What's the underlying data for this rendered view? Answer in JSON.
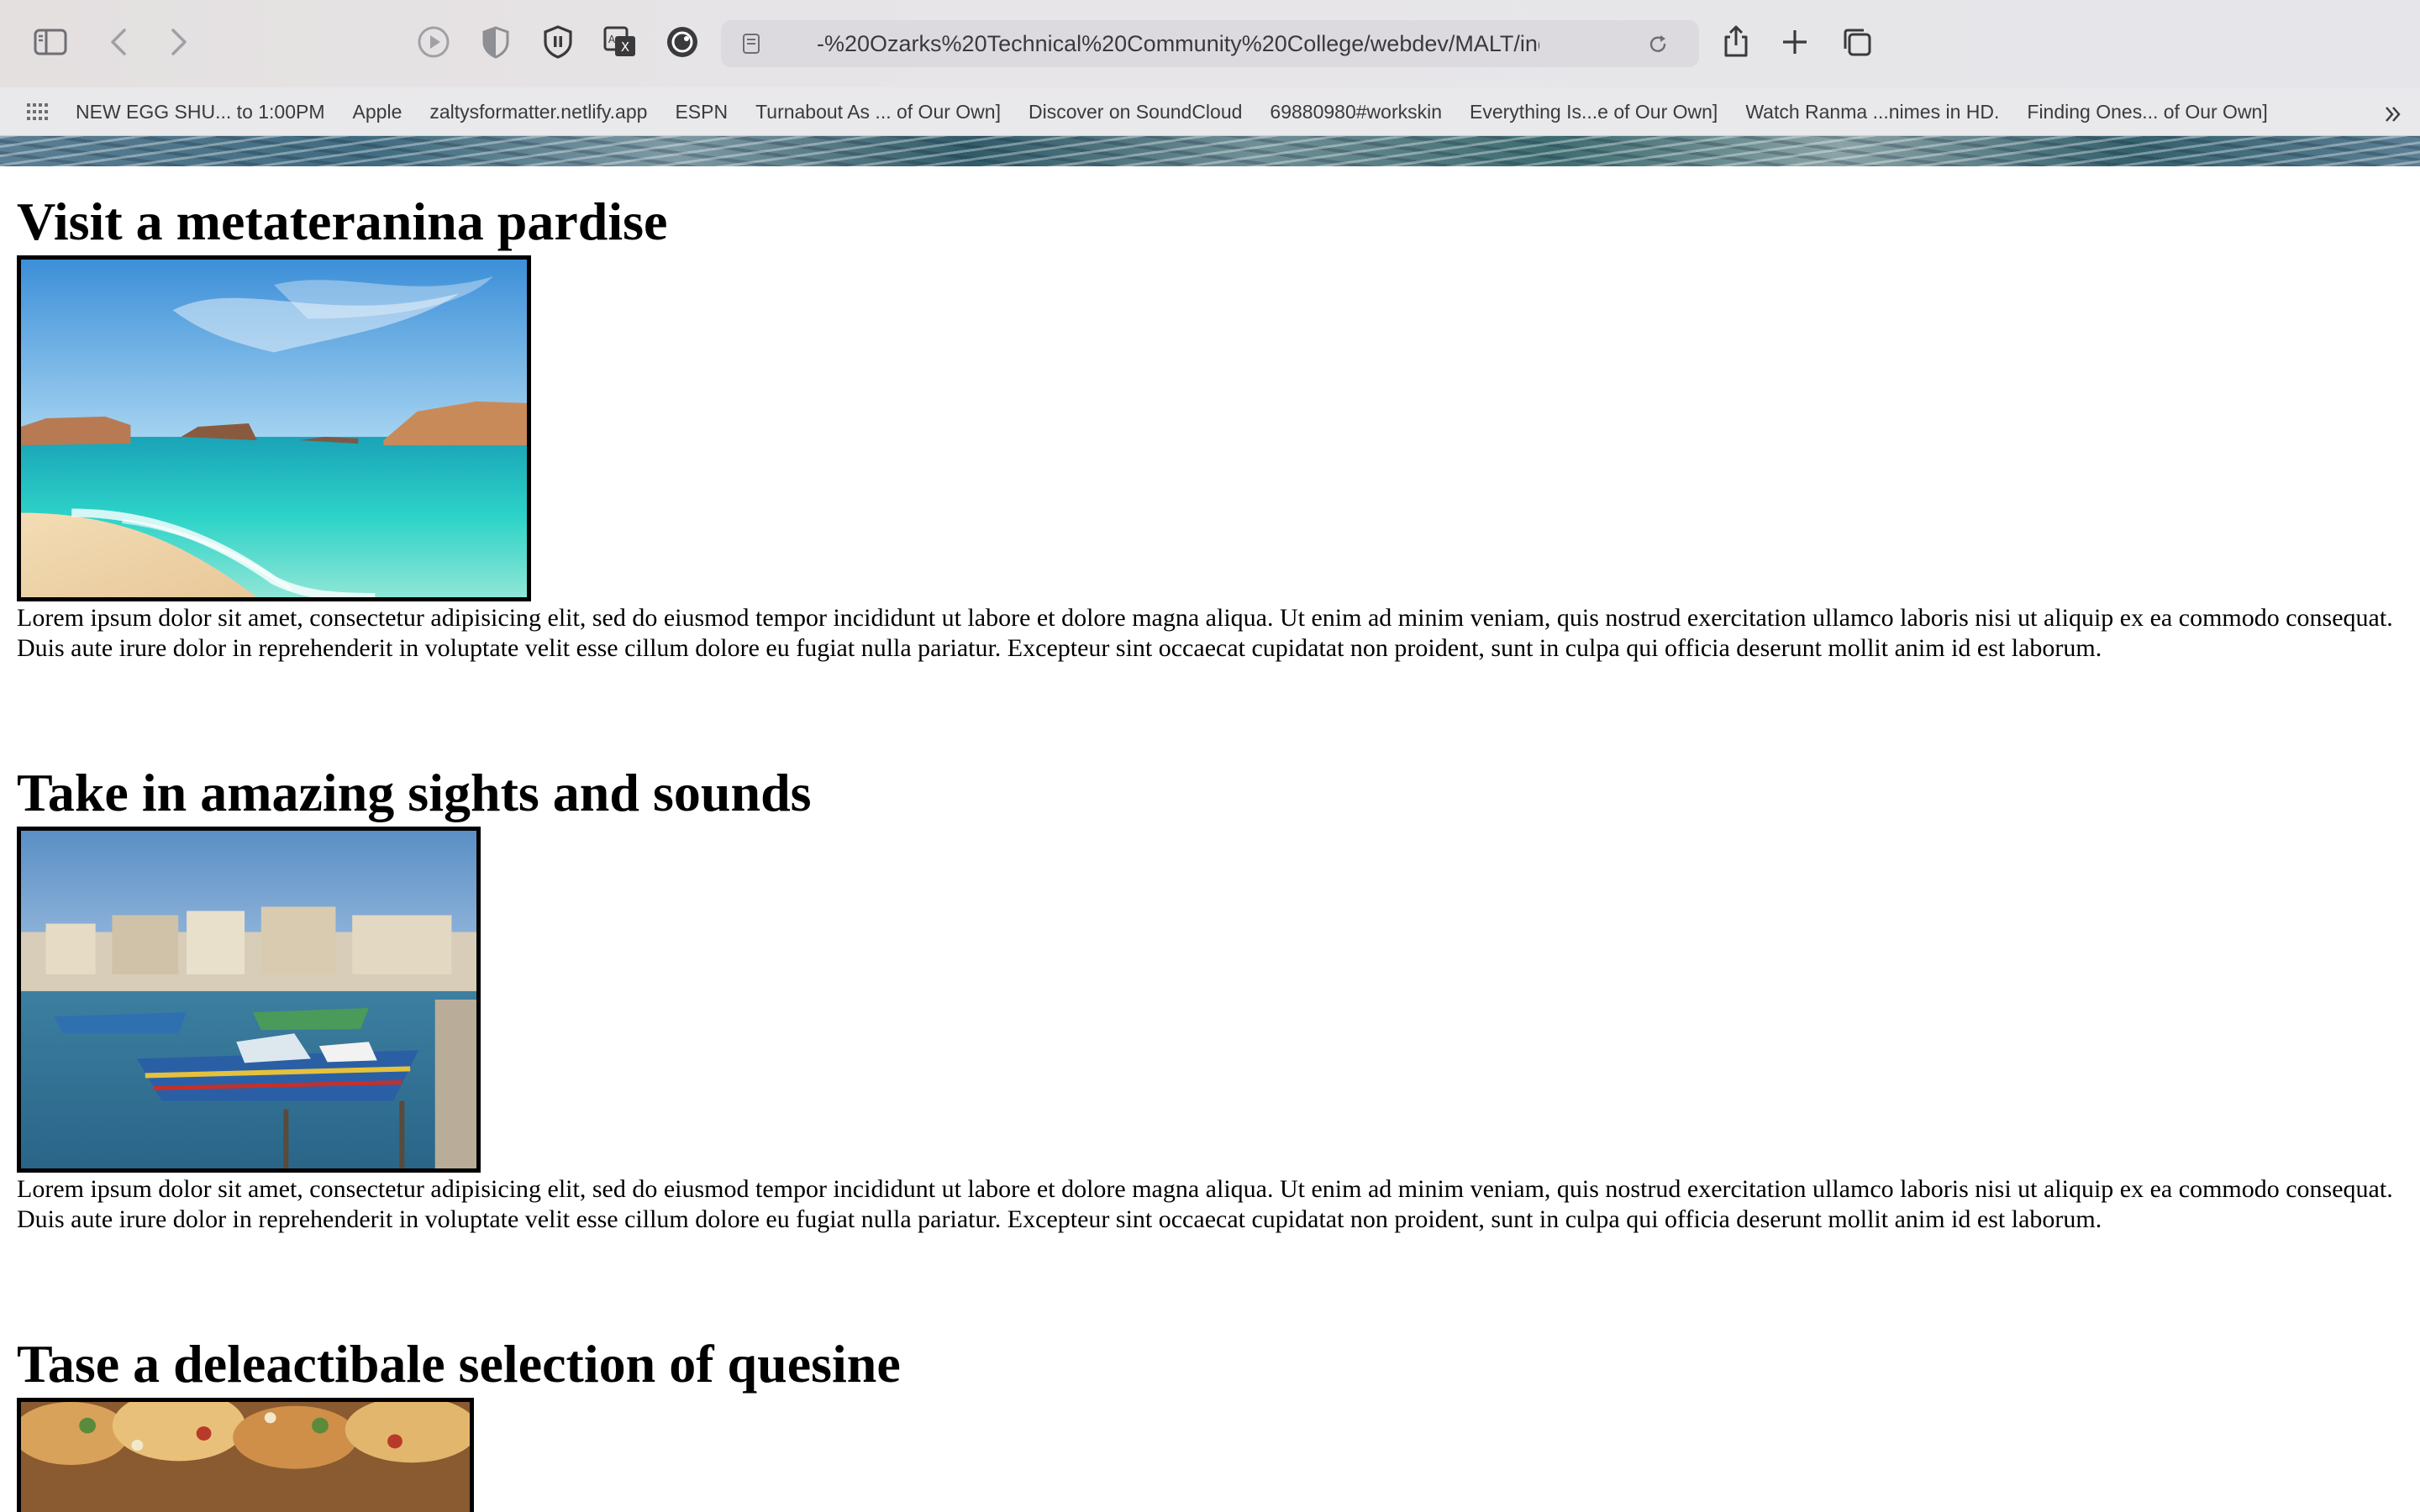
{
  "browser": {
    "url": "-%20Ozarks%20Technical%20Community%20College/webdev/MALT/index.html",
    "bookmarks": [
      "NEW EGG SHU... to 1:00PM",
      "Apple",
      "zaltysformatter.netlify.app",
      "ESPN",
      "Turnabout As ... of Our Own]",
      "Discover on SoundCloud",
      "69880980#workskin",
      "Everything Is...e of Our Own]",
      "Watch Ranma ...nimes in HD.",
      "Finding Ones... of Our Own]"
    ],
    "icons": {
      "sidebar": "sidebar-icon",
      "back": "chevron-left-icon",
      "forward": "chevron-right-icon",
      "play": "play-icon",
      "shield_half": "privacy-shield-icon",
      "shield_extension": "extension-shield-icon",
      "translate": "translate-icon",
      "extension_ghost": "extension-icon",
      "page": "page-icon",
      "reload": "reload-icon",
      "share": "share-icon",
      "new_tab": "plus-icon",
      "tabs": "tab-overview-icon",
      "bookmarks_grid": "grid-icon",
      "more_bookmarks": "double-chevron-right-icon"
    }
  },
  "page": {
    "sections": [
      {
        "title": "Visit a metateranina pardise",
        "image": "beach-photo",
        "text": "Lorem ipsum dolor sit amet, consectetur adipisicing elit, sed do eiusmod tempor incididunt ut labore et dolore magna aliqua. Ut enim ad minim veniam, quis nostrud exercitation ullamco laboris nisi ut aliquip ex ea commodo consequat. Duis aute irure dolor in reprehenderit in voluptate velit esse cillum dolore eu fugiat nulla pariatur. Excepteur sint occaecat cupidatat non proident, sunt in culpa qui officia deserunt mollit anim id est laborum."
      },
      {
        "title": "Take in amazing sights and sounds",
        "image": "harbor-photo",
        "text": "Lorem ipsum dolor sit amet, consectetur adipisicing elit, sed do eiusmod tempor incididunt ut labore et dolore magna aliqua. Ut enim ad minim veniam, quis nostrud exercitation ullamco laboris nisi ut aliquip ex ea commodo consequat. Duis aute irure dolor in reprehenderit in voluptate velit esse cillum dolore eu fugiat nulla pariatur. Excepteur sint occaecat cupidatat non proident, sunt in culpa qui officia deserunt mollit anim id est laborum."
      },
      {
        "title": "Tase a deleactibale selection of quesine",
        "image": "food-photo"
      }
    ]
  }
}
